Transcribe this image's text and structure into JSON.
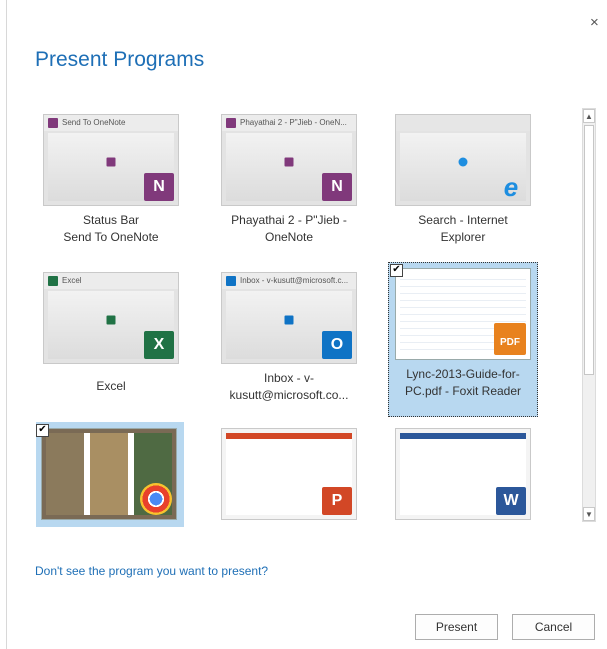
{
  "dialog": {
    "title": "Present Programs",
    "close_glyph": "×",
    "footer_link": "Don't see the program you want to present?",
    "present_label": "Present",
    "cancel_label": "Cancel"
  },
  "programs": [
    {
      "thumb_title": "Send To OneNote",
      "label_line1": "Status Bar",
      "label_line2": "Send To OneNote",
      "icon": "onenote-icon",
      "icon_text": "N",
      "color": "#80397b",
      "checked": false
    },
    {
      "thumb_title": "Phayathai 2 - P\"Jieb - OneN...",
      "label_line1": "Phayathai 2 - P\"Jieb -",
      "label_line2": "OneNote",
      "icon": "onenote-icon",
      "icon_text": "N",
      "color": "#80397b",
      "checked": false
    },
    {
      "thumb_title": "",
      "label_line1": "Search - Internet",
      "label_line2": "Explorer",
      "icon": "internet-explorer-icon",
      "icon_text": "e",
      "color": "#1e8ee0",
      "checked": false
    },
    {
      "thumb_title": "Excel",
      "label_line1": "",
      "label_line2": "Excel",
      "icon": "excel-icon",
      "icon_text": "X",
      "color": "#207245",
      "checked": false
    },
    {
      "thumb_title": "Inbox - v-kusutt@microsoft.c...",
      "label_line1": "Inbox - v-",
      "label_line2": "kusutt@microsoft.co...",
      "icon": "outlook-icon",
      "icon_text": "O",
      "color": "#0f73c5",
      "checked": false
    },
    {
      "thumb_title": "",
      "label_line1": "Lync-2013-Guide-for-",
      "label_line2": "PC.pdf - Foxit Reader",
      "icon": "foxit-pdf-icon",
      "icon_text": "PDF",
      "color": "#e8821e",
      "checked": true
    },
    {
      "thumb_title": "",
      "label_line1": "",
      "label_line2": "",
      "icon": "chrome-icon",
      "icon_text": "",
      "color": "#e8412c",
      "checked": true
    },
    {
      "thumb_title": "",
      "label_line1": "",
      "label_line2": "",
      "icon": "powerpoint-icon",
      "icon_text": "P",
      "color": "#d24726",
      "checked": false
    },
    {
      "thumb_title": "",
      "label_line1": "",
      "label_line2": "",
      "icon": "word-icon",
      "icon_text": "W",
      "color": "#2b579a",
      "checked": false
    }
  ],
  "check_glyph": "✔",
  "scroll": {
    "up_glyph": "▲",
    "down_glyph": "▼"
  }
}
